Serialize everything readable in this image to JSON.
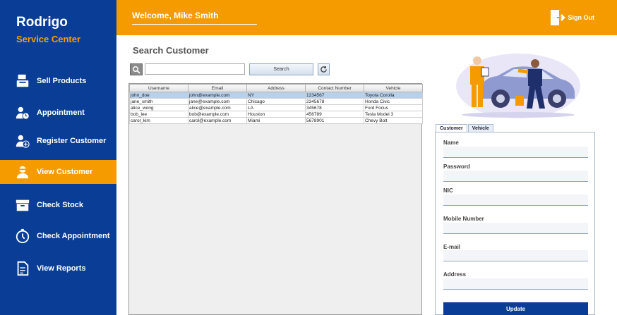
{
  "brand": {
    "line1": "Rodrigo",
    "line2": "Service Center"
  },
  "colors": {
    "sidebar": "#0a3e96",
    "accent": "#f59b00"
  },
  "sidebar": {
    "items": [
      {
        "label": "Sell Products",
        "icon": "cash-register-icon"
      },
      {
        "label": "Appointment",
        "icon": "user-clock-icon"
      },
      {
        "label": "Register Customer",
        "icon": "user-plus-icon"
      },
      {
        "label": "View Customer",
        "icon": "user-view-icon",
        "active": true
      },
      {
        "label": "Check Stock",
        "icon": "box-icon"
      },
      {
        "label": "Check Appointment",
        "icon": "stopwatch-icon"
      },
      {
        "label": "View Reports",
        "icon": "report-icon"
      }
    ]
  },
  "header": {
    "welcome": "Welcome, Mike Smith",
    "signout": "Sign Out"
  },
  "main": {
    "title": "Search Customer",
    "search": {
      "value": "",
      "button": "Search"
    },
    "table": {
      "columns": [
        "Username",
        "Email",
        "Address",
        "Contact Number",
        "Vehicle"
      ],
      "rows": [
        [
          "john_doe",
          "john@example.com",
          "NY",
          "1234567",
          "Toyota Corolla"
        ],
        [
          "jane_smith",
          "jane@example.com",
          "Chicago",
          "2345678",
          "Honda Civic"
        ],
        [
          "alice_wong",
          "alice@example.com",
          "LA",
          "345678",
          "Ford Focus"
        ],
        [
          "bob_lee",
          "bob@example.com",
          "Houston",
          "456789",
          "Tesla Model 3"
        ],
        [
          "carol_kim",
          "carol@example.com",
          "Miami",
          "5678901",
          "Chevy Bolt"
        ]
      ]
    }
  },
  "form": {
    "tabs": [
      "Customer",
      "Vehicle"
    ],
    "fields": {
      "name": "Name",
      "password": "Password",
      "nic": "NIC",
      "mobile": "Mobile Number",
      "email": "E-mail",
      "address": "Address"
    },
    "update": "Update"
  }
}
